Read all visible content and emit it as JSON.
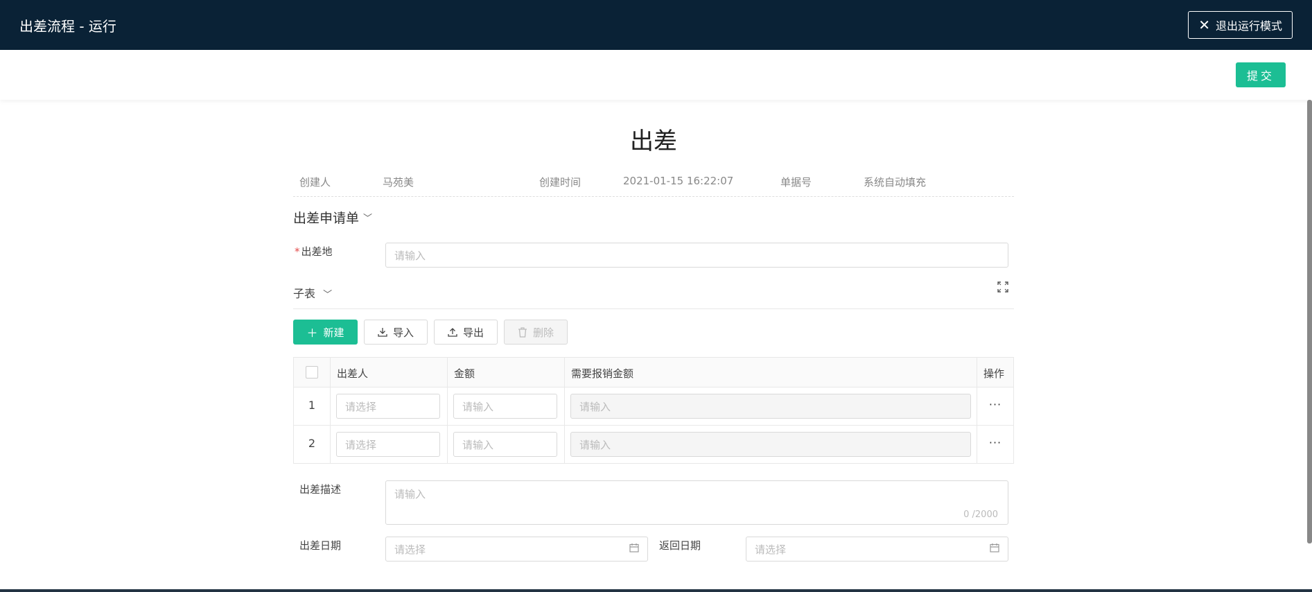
{
  "header": {
    "title": "出差流程 - 运行",
    "exit_label": "退出运行模式"
  },
  "actionbar": {
    "submit_label": "提交"
  },
  "form": {
    "title": "出差",
    "meta": {
      "creator_label": "创建人",
      "creator_value": "马苑美",
      "created_time_label": "创建时间",
      "created_time_value": "2021-01-15 16:22:07",
      "doc_no_label": "单据号",
      "doc_no_value": "系统自动填充"
    },
    "section_title": "出差申请单",
    "destination": {
      "label": "出差地",
      "placeholder": "请输入"
    },
    "subtable": {
      "title": "子表",
      "buttons": {
        "new": "新建",
        "import": "导入",
        "export": "导出",
        "delete": "删除"
      },
      "columns": [
        "出差人",
        "金额",
        "需要报销金额",
        "操作"
      ],
      "rows": [
        {
          "index": "1",
          "traveler_placeholder": "请选择",
          "amount_placeholder": "请输入",
          "reimburse_placeholder": "请输入",
          "action": "···"
        },
        {
          "index": "2",
          "traveler_placeholder": "请选择",
          "amount_placeholder": "请输入",
          "reimburse_placeholder": "请输入",
          "action": "···"
        }
      ]
    },
    "description": {
      "label": "出差描述",
      "placeholder": "请输入",
      "counter": "0 /2000"
    },
    "start_date": {
      "label": "出差日期",
      "placeholder": "请选择"
    },
    "return_date": {
      "label": "返回日期",
      "placeholder": "请选择"
    }
  },
  "colors": {
    "header_bg": "#0a2236",
    "primary": "#1cbe94",
    "required": "#e34d4d"
  }
}
